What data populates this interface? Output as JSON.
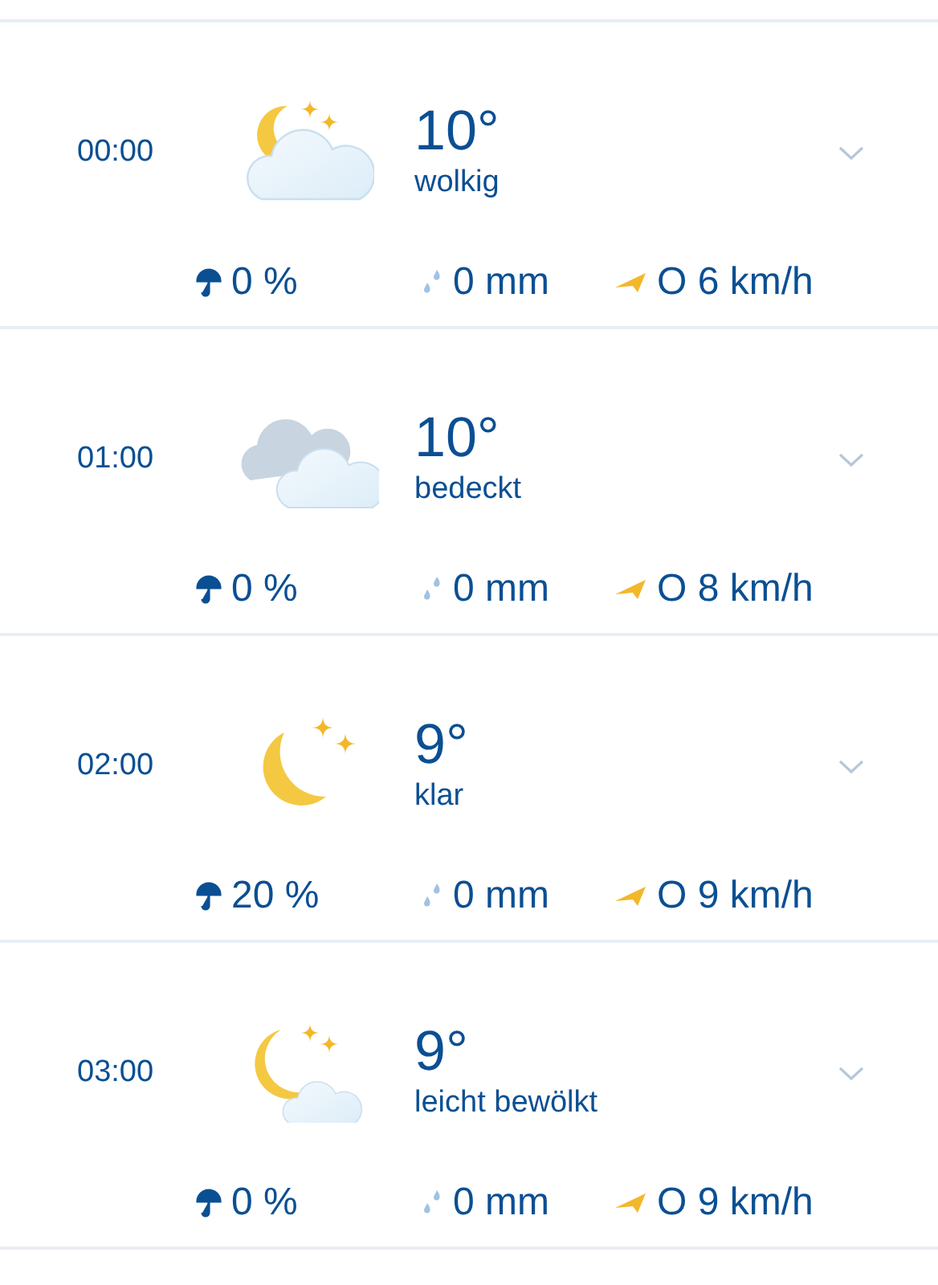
{
  "hours": [
    {
      "time": "00:00",
      "kind": "cloudy",
      "temperature": "10°",
      "condition": "wolkig",
      "precip_chance": "0 %",
      "precip_amount": "0 mm",
      "wind": "O 6 km/h"
    },
    {
      "time": "01:00",
      "kind": "overcast",
      "temperature": "10°",
      "condition": "bedeckt",
      "precip_chance": "0 %",
      "precip_amount": "0 mm",
      "wind": "O 8 km/h"
    },
    {
      "time": "02:00",
      "kind": "clear",
      "temperature": "9°",
      "condition": "klar",
      "precip_chance": "20 %",
      "precip_amount": "0 mm",
      "wind": "O 9 km/h"
    },
    {
      "time": "03:00",
      "kind": "partly",
      "temperature": "9°",
      "condition": "leicht bewölkt",
      "precip_chance": "0 %",
      "precip_amount": "0 mm",
      "wind": "O 9 km/h"
    }
  ]
}
